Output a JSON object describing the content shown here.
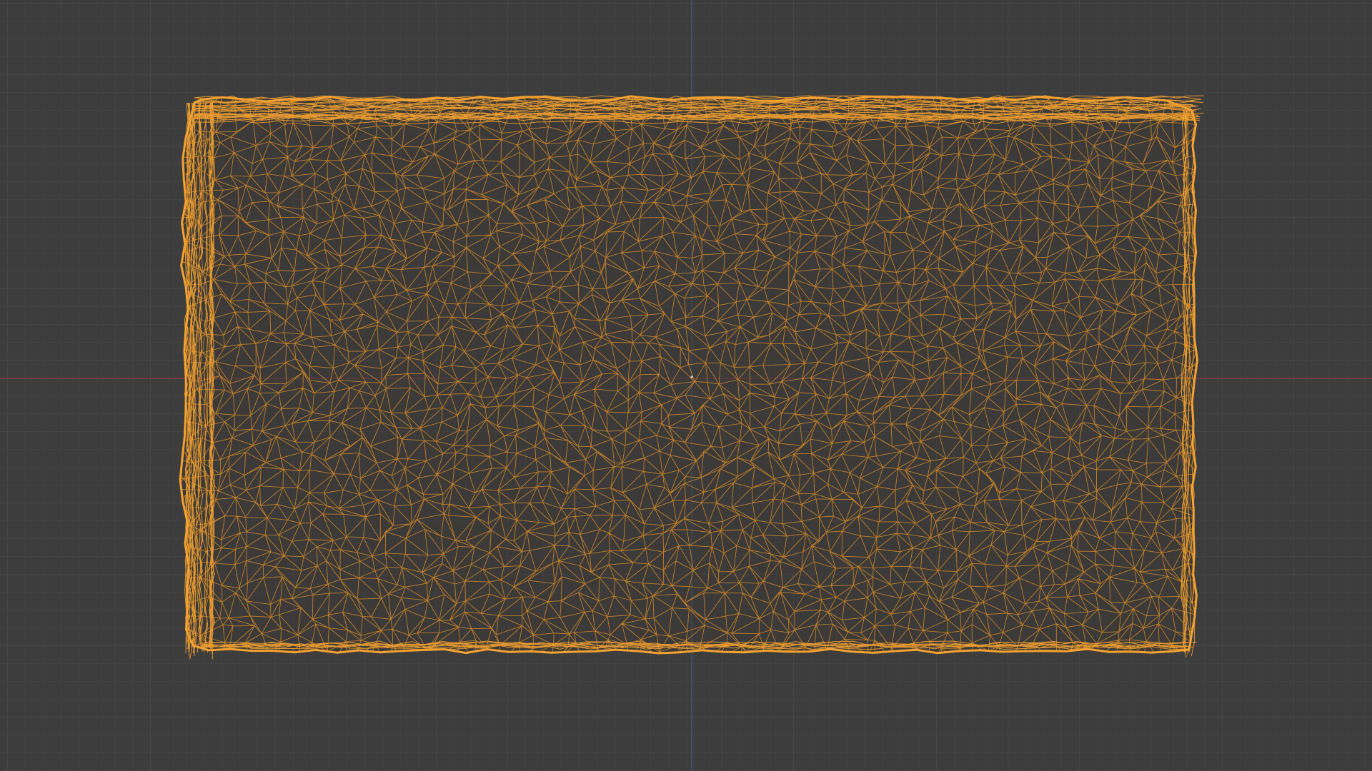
{
  "viewport": {
    "view": "3d-viewport",
    "shading": "wireframe",
    "selected": true
  },
  "colors": {
    "background": "#3d3d3d",
    "grid_minor": "#474747",
    "grid_major": "#525252",
    "axis_x": "#8e3a45",
    "axis_y": "#3e5f8a",
    "wire_selected": "#f5a230",
    "wire_dim": "#d98b24",
    "object_fill": "#3a3836"
  },
  "object": {
    "type": "scanned-mesh",
    "icon": "mesh-icon"
  }
}
